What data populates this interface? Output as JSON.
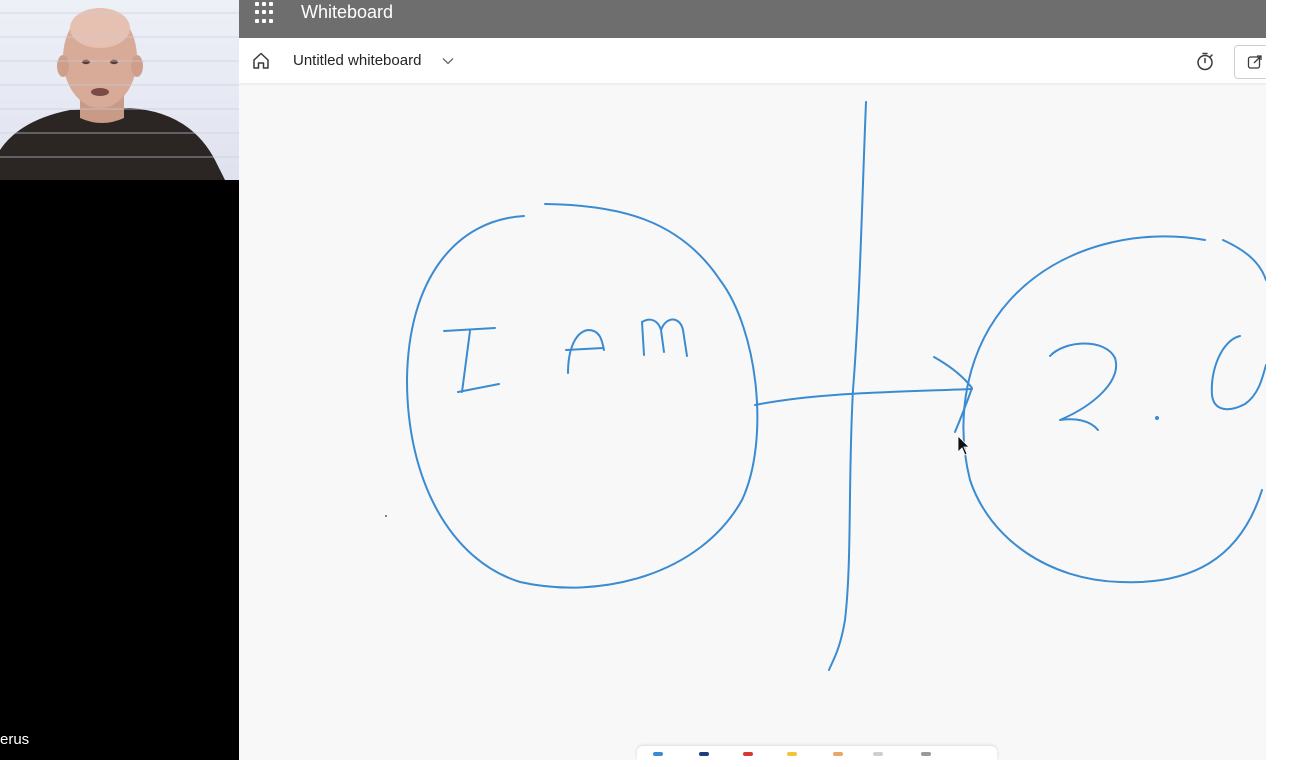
{
  "app": {
    "title": "Whiteboard",
    "board_name": "Untitled whiteboard"
  },
  "meeting": {
    "participant_name_partial": "erus"
  },
  "icons": {
    "launcher": "waffle-icon",
    "home": "home-icon",
    "board_menu": "chevron-down-icon",
    "timer": "timer-icon",
    "share": "share-icon"
  },
  "colors": {
    "ink": "#3a8bd2",
    "app_bar": "#6e6e6e"
  }
}
